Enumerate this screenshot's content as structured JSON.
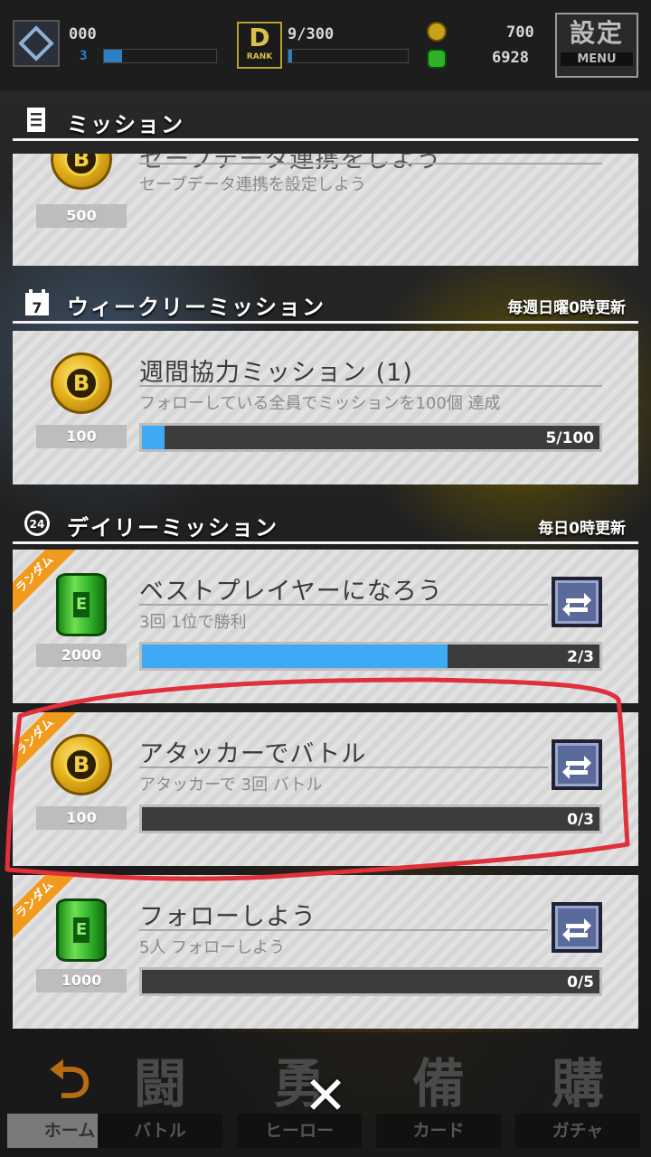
{
  "status_bar": {
    "level_value": "000",
    "level_sub": "3",
    "rank_progress": "9/300",
    "rank_badge": {
      "letter": "D",
      "label": "RANK"
    },
    "coins": "700",
    "energy": "6928",
    "menu_kanji": "設定",
    "menu_label": "MENU"
  },
  "sections": {
    "missions": {
      "title": "ミッション"
    },
    "weekly": {
      "title": "ウィークリーミッション",
      "note": "毎週日曜0時更新"
    },
    "daily": {
      "title": "デイリーミッション",
      "note": "毎日0時更新"
    }
  },
  "missions_top": {
    "partial_title": "セーブデータ連携をしよう",
    "description": "セーブデータ連携を設定しよう",
    "reward_amount": "500",
    "reward_type": "coin"
  },
  "weekly_missions": [
    {
      "title": "週間協力ミッション (1)",
      "description": "フォローしている全員でミッションを100個 達成",
      "reward_amount": "100",
      "reward_type": "coin",
      "progress_text": "5/100",
      "progress_fraction": 0.05
    }
  ],
  "daily_missions": [
    {
      "ribbon": "ランダム",
      "title": "ベストプレイヤーになろう",
      "description": "3回 1位で勝利",
      "reward_amount": "2000",
      "reward_type": "can",
      "progress_text": "2/3",
      "progress_fraction": 0.667
    },
    {
      "ribbon": "ランダム",
      "title": "アタッカーでバトル",
      "description": "アタッカーで 3回 バトル",
      "reward_amount": "100",
      "reward_type": "coin",
      "progress_text": "0/3",
      "progress_fraction": 0
    },
    {
      "ribbon": "ランダム",
      "title": "フォローしよう",
      "description": "5人 フォローしよう",
      "reward_amount": "1000",
      "reward_type": "can",
      "progress_text": "0/5",
      "progress_fraction": 0
    }
  ],
  "coin_letter": "B",
  "can_letter": "E",
  "bottom_nav": [
    {
      "glyph": "⮌",
      "label": "ホーム"
    },
    {
      "glyph": "闘",
      "label": "バトル"
    },
    {
      "glyph": "勇",
      "label": "ヒーロー"
    },
    {
      "glyph": "備",
      "label": "カード"
    },
    {
      "glyph": "購",
      "label": "ガチャ"
    }
  ],
  "close_symbol": "✕",
  "colors": {
    "progress_fill": "#3eaaf5",
    "ribbon": "#f29a1e",
    "annotation_stroke": "#e0303a"
  }
}
